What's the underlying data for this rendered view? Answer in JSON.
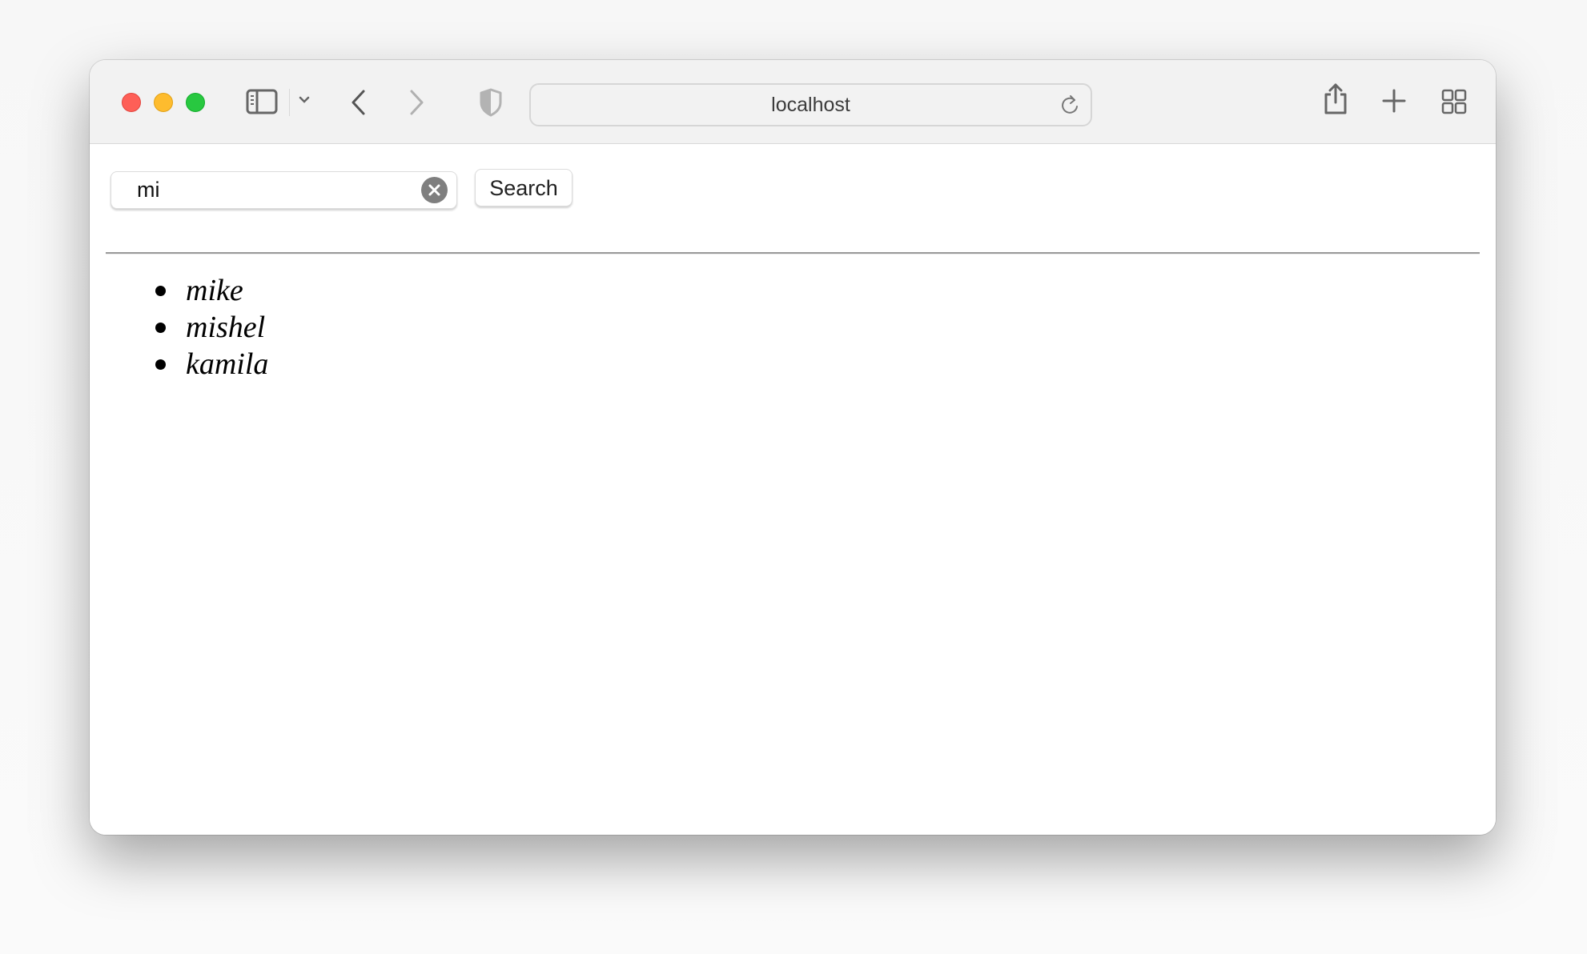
{
  "browser": {
    "window_controls": [
      "close",
      "minimize",
      "zoom"
    ],
    "toolbar_icons": {
      "sidebar": "sidebar-icon",
      "sidebar_menu": "chevron-down-icon",
      "back": "chevron-left-icon",
      "forward": "chevron-right-icon",
      "privacy": "shield-icon",
      "reload": "reload-icon",
      "share": "share-icon",
      "new_tab": "plus-icon",
      "tab_overview": "grid-icon"
    },
    "address": "localhost"
  },
  "page": {
    "search": {
      "value": "mi",
      "clear_icon": "clear-circle-icon",
      "button_label": "Search"
    },
    "results": [
      {
        "name": "mike"
      },
      {
        "name": "mishel"
      },
      {
        "name": "kamila"
      }
    ]
  },
  "colors": {
    "close": "#fe5f57",
    "minimize": "#febc2e",
    "zoom": "#28c840",
    "toolbar_bg": "#f2f2f2"
  }
}
